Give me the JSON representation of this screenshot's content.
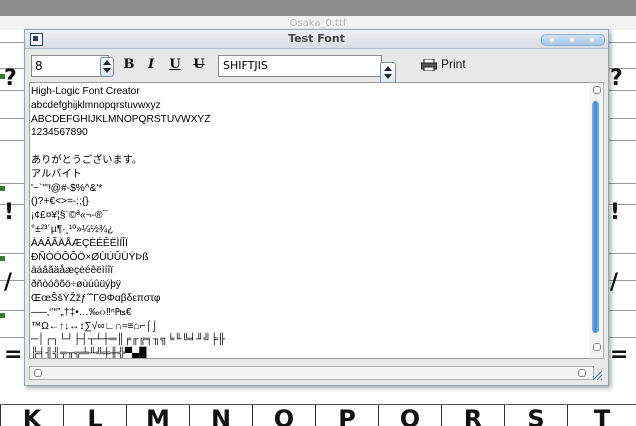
{
  "background": {
    "window_title": "Osaka_0.ttf",
    "left_glyphs": [
      "?",
      "!",
      "/",
      "="
    ],
    "right_glyphs": [
      "?",
      "!",
      "/",
      "="
    ],
    "bottom_glyphs": [
      "K",
      "L",
      "M",
      "N",
      "O",
      "P",
      "Q",
      "R",
      "S",
      "T"
    ]
  },
  "window": {
    "title": "Test Font",
    "title_icon": "window-menu-icon"
  },
  "toolbar": {
    "size_value": "8",
    "bold_label": "B",
    "italic_label": "I",
    "underline_label": "U",
    "strike_label": "U",
    "charset_value": "SHIFTJIS",
    "print_label": "Print",
    "print_icon": "printer-icon"
  },
  "sample_lines": [
    "High-Logic Font Creator",
    "abcdefghijklmnopqrstuvwxyz",
    "ABCDEFGHIJKLMNOPQRSTUVWXYZ",
    "1234567890",
    "",
    "ありがとうございます。",
    "アルバイト",
    "'~`'\"!@#-$%^&'*",
    "()?+€<>=-:;{}",
    "¡¢£¤¥¦§¨©ª«¬-®¯",
    "°±²³´µ¶·¸¹º»¼½¾¿",
    "ÀÁÂÃÄÅÆÇÈÉÊËÌÍÎÏ",
    "ÐÑÒÓÔÕÖ×ØÙÚÛÜÝÞß",
    "àáâãäåæçèéêëìíîï",
    "ðñòóôõö÷øùúûüýþÿ",
    "ŒœŠšŸŽžƒˆ˜ΓΘΦαβδεπστφ",
    "–—‚‘’“”„†‡•…‰‹›‼ⁿ₧€",
    "™Ω←↑↓↔↕∑√∞∟∩≈≡⌂⌐⌠⌡",
    "─│┌┐└┘├┤┬┴┼═║╒╓╔╕╖╗╘╙╚╛╜╝╞╟",
    "╠╡╢╣╤╥╦╧╨╩╪╫╬▀▄█"
  ],
  "colors": {
    "scroll_thumb": "#3f86dc",
    "background_titlebar": "#8c8c8c"
  }
}
